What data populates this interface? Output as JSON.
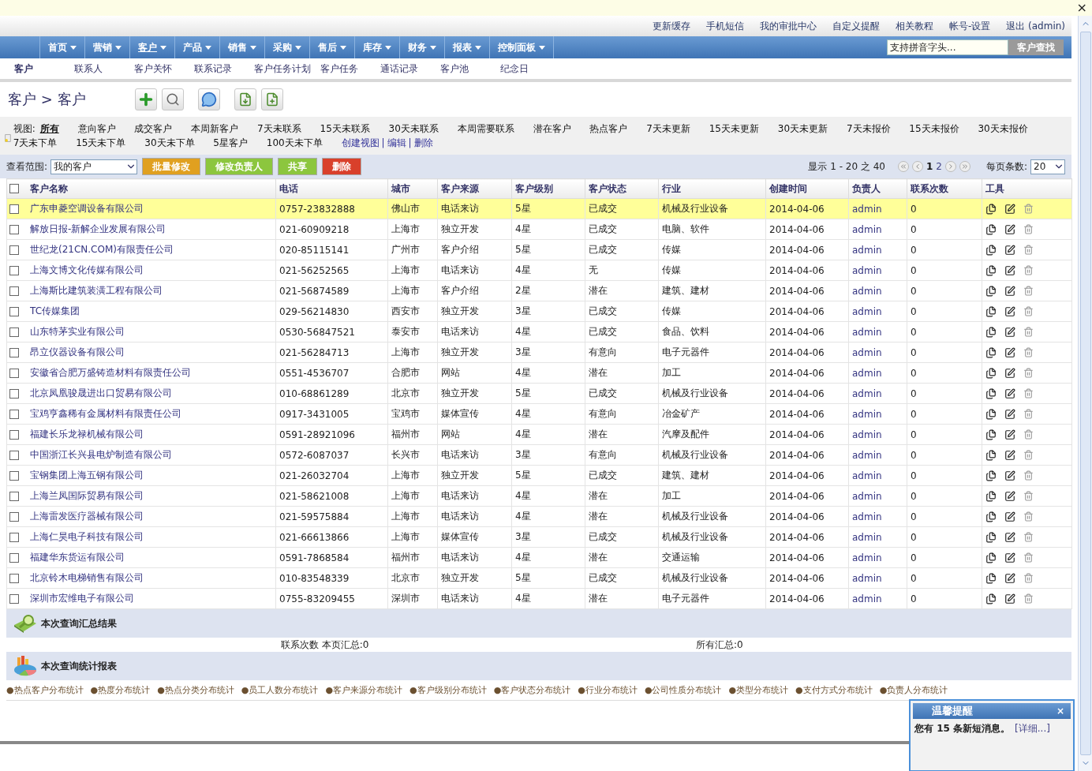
{
  "info_bar": {
    "close": "×"
  },
  "top_links": [
    "更新缓存",
    "手机短信",
    "我的审批中心",
    "自定义提醒",
    "相关教程",
    "帐号-设置",
    "退出 (admin)"
  ],
  "nav": {
    "items": [
      {
        "label": "首页",
        "selected": false
      },
      {
        "label": "营销",
        "selected": false
      },
      {
        "label": "客户",
        "selected": true
      },
      {
        "label": "产品",
        "selected": false
      },
      {
        "label": "销售",
        "selected": false
      },
      {
        "label": "采购",
        "selected": false
      },
      {
        "label": "售后",
        "selected": false
      },
      {
        "label": "库存",
        "selected": false
      },
      {
        "label": "财务",
        "selected": false
      },
      {
        "label": "报表",
        "selected": false
      },
      {
        "label": "控制面板",
        "selected": false
      }
    ],
    "search": {
      "placeholder": "支持拼音字头..."
    },
    "search_button": {
      "label": "客户查找",
      "disabled": true
    }
  },
  "sub_nav": [
    {
      "label": "客户",
      "selected": true
    },
    {
      "label": "联系人",
      "selected": false
    },
    {
      "label": "客户关怀",
      "selected": false
    },
    {
      "label": "联系记录",
      "selected": false
    },
    {
      "label": "客户任务计划",
      "selected": false
    },
    {
      "label": "客户任务",
      "selected": false
    },
    {
      "label": "通话记录",
      "selected": false
    },
    {
      "label": "客户池",
      "selected": false
    },
    {
      "label": "纪念日",
      "selected": false
    }
  ],
  "breadcrumb": "客户 > 客户",
  "views": {
    "label": "视图:",
    "items": [
      {
        "label": "所有",
        "selected": true
      },
      {
        "label": "意向客户",
        "selected": false
      },
      {
        "label": "成交客户",
        "selected": false
      },
      {
        "label": "本周新客户",
        "selected": false
      },
      {
        "label": "7天未联系",
        "selected": false
      },
      {
        "label": "15天未联系",
        "selected": false
      },
      {
        "label": "30天未联系",
        "selected": false
      },
      {
        "label": "本周需要联系",
        "selected": false
      },
      {
        "label": "潜在客户",
        "selected": false
      },
      {
        "label": "热点客户",
        "selected": false
      },
      {
        "label": "7天未更新",
        "selected": false
      },
      {
        "label": "15天未更新",
        "selected": false
      },
      {
        "label": "30天未更新",
        "selected": false
      },
      {
        "label": "7天未报价",
        "selected": false
      },
      {
        "label": "15天未报价",
        "selected": false
      },
      {
        "label": "30天未报价",
        "selected": false
      },
      {
        "label": "7天未下单",
        "selected": false
      },
      {
        "label": "15天未下单",
        "selected": false
      },
      {
        "label": "30天未下单",
        "selected": false
      },
      {
        "label": "5星客户",
        "selected": false
      },
      {
        "label": "100天未下单",
        "selected": false
      }
    ],
    "actions": [
      "创建视图",
      "编辑",
      "删除"
    ],
    "separator": "|"
  },
  "filter": {
    "label": "查看范围:",
    "scope": "我的客户",
    "buttons": [
      {
        "label": "批量修改",
        "color": "#e0a020"
      },
      {
        "label": "修改负责人",
        "color": "#8cc63e"
      },
      {
        "label": "共享",
        "color": "#8cc63e"
      },
      {
        "label": "删除",
        "color": "#d9402b"
      }
    ],
    "range": "显示 1 - 20 之 40",
    "pages": [
      {
        "label": "1",
        "selected": true
      },
      {
        "label": "2",
        "selected": false
      }
    ],
    "per_page_label": "每页条数:",
    "per_page": "20"
  },
  "table": {
    "header_checked": false,
    "columns": [
      "客户名称",
      "电话",
      "城市",
      "客户来源",
      "客户级别",
      "客户状态",
      "行业",
      "创建时间",
      "负责人",
      "联系次数",
      "工具"
    ],
    "rows": [
      {
        "selected": true,
        "checked": false,
        "cells": [
          "广东申菱空调设备有限公司",
          "0757-23832888",
          "佛山市",
          "电话来访",
          "5星",
          "已成交",
          "机械及行业设备",
          "2014-04-06",
          "admin",
          "0"
        ]
      },
      {
        "selected": false,
        "checked": false,
        "cells": [
          "解放日报-新解企业发展有限公司",
          "021-60909218",
          "上海市",
          "独立开发",
          "4星",
          "已成交",
          "电脑、软件",
          "2014-04-06",
          "admin",
          "0"
        ]
      },
      {
        "selected": false,
        "checked": false,
        "cells": [
          "世纪龙(21CN.COM)有限责任公司",
          "020-85115141",
          "广州市",
          "客户介绍",
          "5星",
          "已成交",
          "传媒",
          "2014-04-06",
          "admin",
          "0"
        ]
      },
      {
        "selected": false,
        "checked": false,
        "cells": [
          "上海文博文化传媒有限公司",
          "021-56252565",
          "上海市",
          "电话来访",
          "4星",
          "无",
          "传媒",
          "2014-04-06",
          "admin",
          "0"
        ]
      },
      {
        "selected": false,
        "checked": false,
        "cells": [
          "上海斯比建筑装潢工程有限公司",
          "021-56874589",
          "上海市",
          "客户介绍",
          "2星",
          "潜在",
          "建筑、建材",
          "2014-04-06",
          "admin",
          "0"
        ]
      },
      {
        "selected": false,
        "checked": false,
        "cells": [
          "TC传媒集团",
          "029-56214830",
          "西安市",
          "独立开发",
          "3星",
          "已成交",
          "传媒",
          "2014-04-06",
          "admin",
          "0"
        ]
      },
      {
        "selected": false,
        "checked": false,
        "cells": [
          "山东特茅实业有限公司",
          "0530-56847521",
          "泰安市",
          "电话来访",
          "4星",
          "已成交",
          "食品、饮料",
          "2014-04-06",
          "admin",
          "0"
        ]
      },
      {
        "selected": false,
        "checked": false,
        "cells": [
          "昂立仪器设备有限公司",
          "021-56284713",
          "上海市",
          "独立开发",
          "3星",
          "有意向",
          "电子元器件",
          "2014-04-06",
          "admin",
          "0"
        ]
      },
      {
        "selected": false,
        "checked": false,
        "cells": [
          "安徽省合肥万盛铸造材料有限责任公司",
          "0551-4536707",
          "合肥市",
          "网站",
          "4星",
          "潜在",
          "加工",
          "2014-04-06",
          "admin",
          "0"
        ]
      },
      {
        "selected": false,
        "checked": false,
        "cells": [
          "北京凤凰骏晟进出口贸易有限公司",
          "010-68861289",
          "北京市",
          "独立开发",
          "5星",
          "已成交",
          "机械及行业设备",
          "2014-04-06",
          "admin",
          "0"
        ]
      },
      {
        "selected": false,
        "checked": false,
        "cells": [
          "宝鸡亨鑫稀有金属材料有限责任公司",
          "0917-3431005",
          "宝鸡市",
          "媒体宣传",
          "4星",
          "有意向",
          "冶金矿产",
          "2014-04-06",
          "admin",
          "0"
        ]
      },
      {
        "selected": false,
        "checked": false,
        "cells": [
          "福建长乐龙禄机械有限公司",
          "0591-28921096",
          "福州市",
          "网站",
          "4星",
          "潜在",
          "汽摩及配件",
          "2014-04-06",
          "admin",
          "0"
        ]
      },
      {
        "selected": false,
        "checked": false,
        "cells": [
          "中国浙江长兴县电炉制造有限公司",
          "0572-6087037",
          "长兴市",
          "电话来访",
          "3星",
          "有意向",
          "机械及行业设备",
          "2014-04-06",
          "admin",
          "0"
        ]
      },
      {
        "selected": false,
        "checked": false,
        "cells": [
          "宝钢集团上海五钢有限公司",
          "021-26032704",
          "上海市",
          "独立开发",
          "5星",
          "已成交",
          "建筑、建材",
          "2014-04-06",
          "admin",
          "0"
        ]
      },
      {
        "selected": false,
        "checked": false,
        "cells": [
          "上海兰凤国际贸易有限公司",
          "021-58621008",
          "上海市",
          "电话来访",
          "4星",
          "潜在",
          "加工",
          "2014-04-06",
          "admin",
          "0"
        ]
      },
      {
        "selected": false,
        "checked": false,
        "cells": [
          "上海雷发医疗器械有限公司",
          "021-59575884",
          "上海市",
          "电话来访",
          "4星",
          "潜在",
          "机械及行业设备",
          "2014-04-06",
          "admin",
          "0"
        ]
      },
      {
        "selected": false,
        "checked": false,
        "cells": [
          "上海仁昊电子科技有限公司",
          "021-66613866",
          "上海市",
          "媒体宣传",
          "3星",
          "已成交",
          "机械及行业设备",
          "2014-04-06",
          "admin",
          "0"
        ]
      },
      {
        "selected": false,
        "checked": false,
        "cells": [
          "福建华东货运有限公司",
          "0591-7868584",
          "福州市",
          "电话来访",
          "4星",
          "潜在",
          "交通运输",
          "2014-04-06",
          "admin",
          "0"
        ]
      },
      {
        "selected": false,
        "checked": false,
        "cells": [
          "北京铃木电梯销售有限公司",
          "010-83548339",
          "北京市",
          "独立开发",
          "5星",
          "已成交",
          "机械及行业设备",
          "2014-04-06",
          "admin",
          "0"
        ]
      },
      {
        "selected": false,
        "checked": false,
        "cells": [
          "深圳市宏维电子有限公司",
          "0755-83209455",
          "深圳市",
          "电话来访",
          "4星",
          "潜在",
          "电子元器件",
          "2014-04-06",
          "admin",
          "0"
        ]
      }
    ]
  },
  "summary": {
    "title": "本次查询汇总结果",
    "page_total": "联系次数  本页汇总:0",
    "all_total": "所有汇总:0"
  },
  "reports": {
    "title": "本次查询统计报表",
    "links": [
      "●热点客户分布统计",
      "●热度分布统计",
      "●热点分类分布统计",
      "●员工人数分布统计",
      "●客户来源分布统计",
      "●客户级别分布统计",
      "●客户状态分布统计",
      "●行业分布统计",
      "●公司性质分布统计",
      "●类型分布统计",
      "●支付方式分布统计",
      "●负责人分布统计"
    ]
  },
  "popup": {
    "title": "温馨提醒",
    "close": "×",
    "message": "您有 **15** 条新短消息。",
    "link": "[详细...]"
  }
}
